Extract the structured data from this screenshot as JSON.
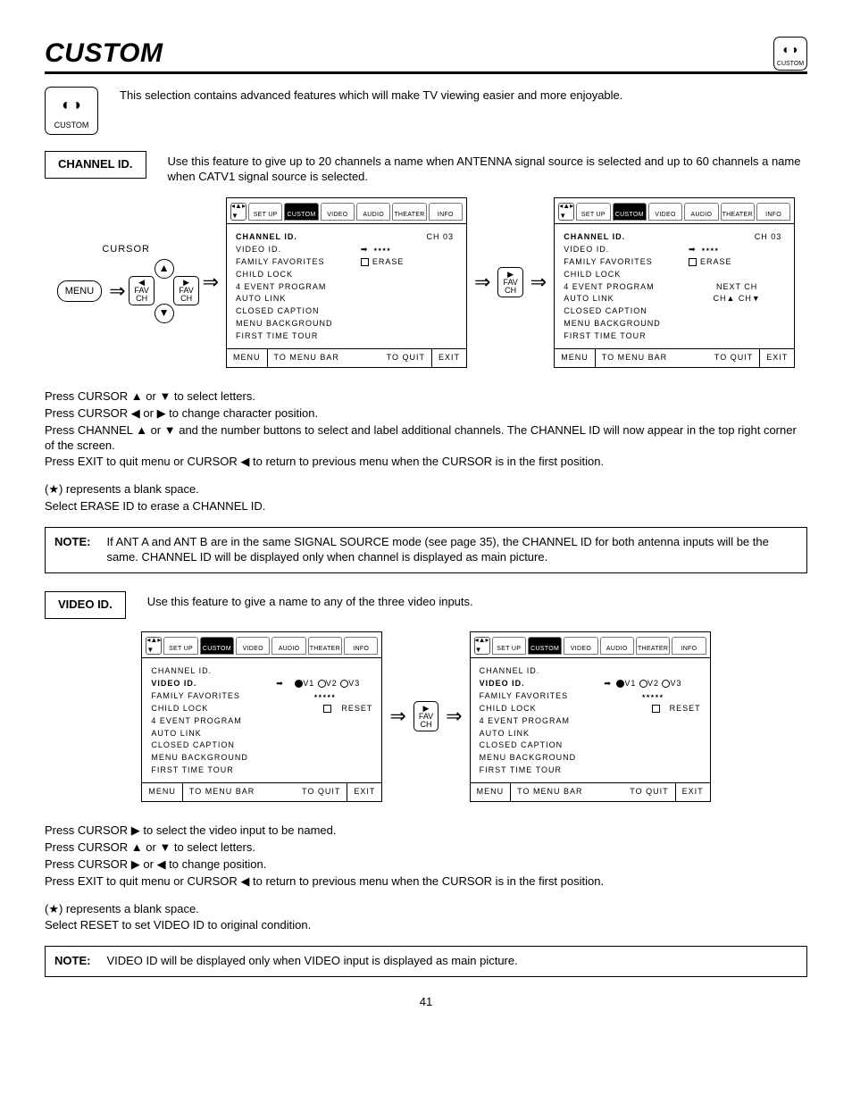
{
  "page_title": "CUSTOM",
  "corner_icon_label": "CUSTOM",
  "intro_icon_label": "CUSTOM",
  "intro_text": "This selection contains advanced features which will make TV viewing easier and more enjoyable.",
  "section1": {
    "label": "CHANNEL ID.",
    "desc": "Use this feature to give up to 20 channels a name when ANTENNA signal source is selected and up to 60 channels a name when CATV1 signal source is selected."
  },
  "remote": {
    "cursor": "CURSOR",
    "menu": "MENU",
    "fav": "FAV",
    "ch": "CH"
  },
  "tabs": [
    "SET UP",
    "CUSTOM",
    "VIDEO",
    "AUDIO",
    "THEATER",
    "INFO"
  ],
  "menu_items": {
    "channel_id": "CHANNEL ID.",
    "video_id": "VIDEO ID.",
    "family_favorites": "FAMILY FAVORITES",
    "child_lock": "CHILD LOCK",
    "four_event": "4 EVENT PROGRAM",
    "auto_link": "AUTO LINK",
    "closed_caption": "CLOSED CAPTION",
    "menu_background": "MENU BACKGROUND",
    "first_time_tour": "FIRST TIME TOUR"
  },
  "osd_right": {
    "ch": "CH 03",
    "stars4": "٭٭٭٭",
    "stars5": "٭٭٭٭٭",
    "erase": "ERASE",
    "next_ch": "NEXT CH",
    "ch_up": "CH▲",
    "ch_down": "CH▼",
    "v1": "V1",
    "v2": "V2",
    "v3": "V3",
    "reset": "RESET"
  },
  "foot": {
    "menu": "MENU",
    "bar": "TO MENU BAR",
    "quit": "TO QUIT",
    "exit": "EXIT"
  },
  "instr1": {
    "l1": "Press CURSOR ▲ or ▼ to select letters.",
    "l2": "Press CURSOR ◀ or ▶ to change character position.",
    "l3": "Press CHANNEL ▲ or ▼ and the number buttons to select and label additional channels.  The CHANNEL ID will now appear in the top right corner of the screen.",
    "l4": "Press EXIT to quit menu or CURSOR ◀ to return to previous menu when the CURSOR is in the first position.",
    "l5": "(★) represents a blank space.",
    "l6": "Select ERASE ID to erase a CHANNEL ID."
  },
  "note1": {
    "label": "NOTE:",
    "text": "If ANT A and ANT B are in the same SIGNAL SOURCE mode (see page 35), the CHANNEL ID for both antenna inputs will be the same.   CHANNEL ID will be displayed only when channel is displayed as main picture."
  },
  "section2": {
    "label": "VIDEO ID.",
    "desc": "Use this feature to give a name to any of the three video inputs."
  },
  "instr2": {
    "l1": "Press CURSOR ▶ to select the video input to be named.",
    "l2": "Press CURSOR ▲ or ▼ to select letters.",
    "l3": "Press CURSOR ▶ or ◀ to change position.",
    "l4": "Press EXIT to quit menu or CURSOR ◀ to return to previous menu when the CURSOR is in the first position.",
    "l5": "(★) represents a blank space.",
    "l6": "Select RESET to set VIDEO ID to original condition."
  },
  "note2": {
    "label": "NOTE:",
    "text": "VIDEO ID will be displayed only when VIDEO input is displayed as main picture."
  },
  "page_number": "41"
}
